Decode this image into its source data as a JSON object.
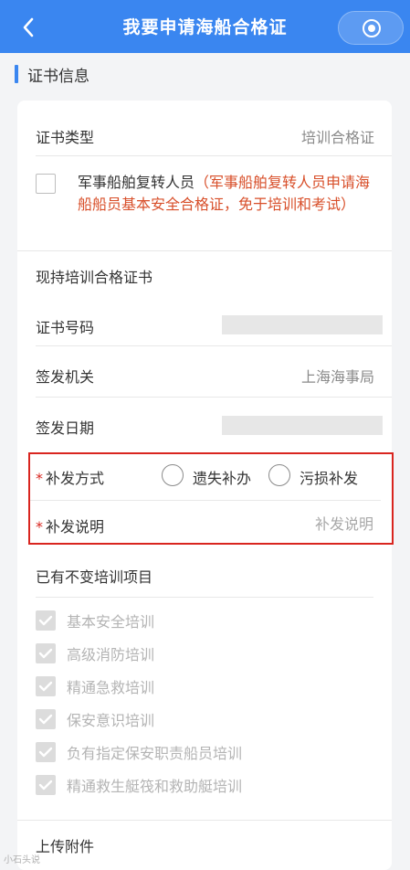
{
  "header": {
    "title": "我要申请海船合格证",
    "back_icon": "chevron-left-icon",
    "menu_icon": "target-circle-icon",
    "bar_color": "#3a86f0"
  },
  "section": {
    "title": "证书信息"
  },
  "cert_type": {
    "label": "证书类型",
    "value": "培训合格证"
  },
  "veteran": {
    "label": "军事船舶复转人员",
    "note": "（军事船舶复转人员申请海船船员基本安全合格证，免于培训和考试）",
    "checked": false
  },
  "current_cert": {
    "label": "现持培训合格证书"
  },
  "cert_number": {
    "label": "证书号码"
  },
  "issuer": {
    "label": "签发机关",
    "value": "上海海事局"
  },
  "issue_date": {
    "label": "签发日期"
  },
  "reissue": {
    "required_mark": "*",
    "method_label": "补发方式",
    "options": [
      "遗失补办",
      "污损补发"
    ],
    "desc_label": "补发说明",
    "desc_placeholder": "补发说明",
    "highlight_color": "#d9251f"
  },
  "training": {
    "title": "已有不变培训项目",
    "items": [
      {
        "label": "基本安全培训",
        "checked": true
      },
      {
        "label": "高级消防培训",
        "checked": true
      },
      {
        "label": "精通急救培训",
        "checked": true
      },
      {
        "label": "保安意识培训",
        "checked": true
      },
      {
        "label": "负有指定保安职责船员培训",
        "checked": true
      },
      {
        "label": "精通救生艇筏和救助艇培训",
        "checked": true
      }
    ]
  },
  "upload": {
    "label": "上传附件"
  },
  "watermark": {
    "text": "小石头说"
  }
}
